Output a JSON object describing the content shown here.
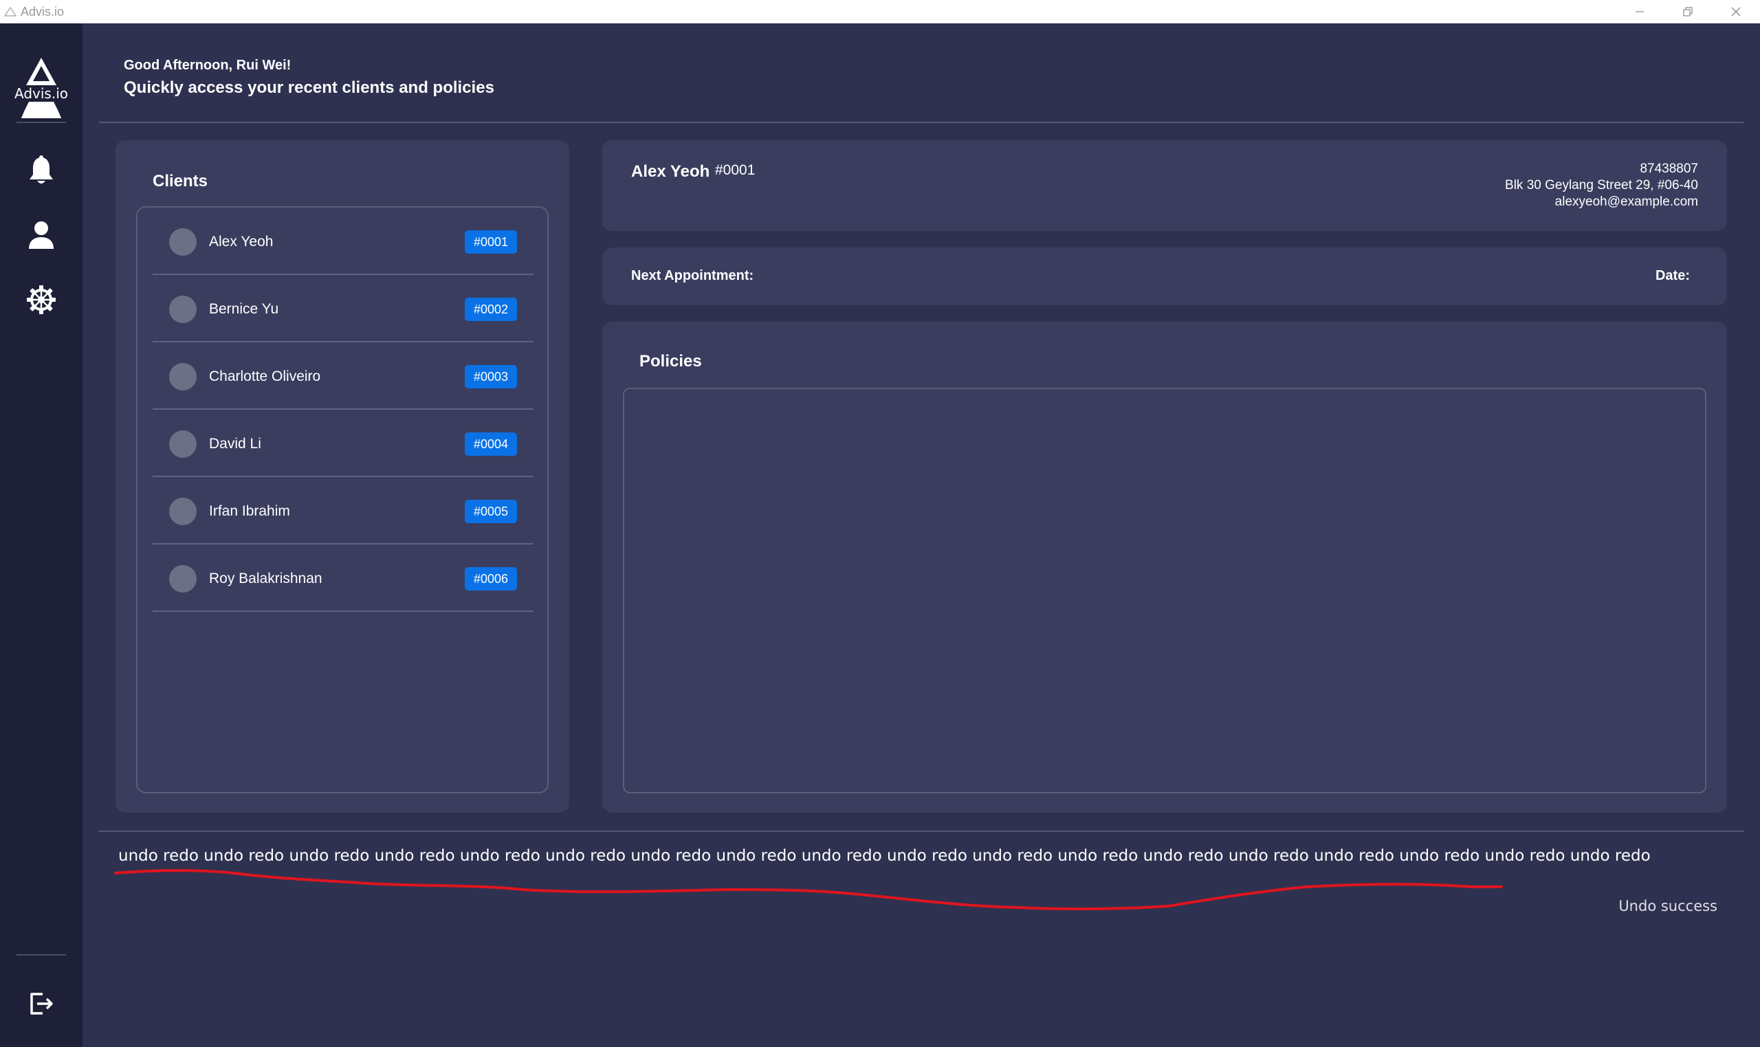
{
  "window": {
    "title": "Advis.io"
  },
  "sidebar": {
    "logo_text": "Advis.io",
    "items": [
      {
        "icon": "bell-icon"
      },
      {
        "icon": "user-icon"
      },
      {
        "icon": "gear-icon"
      }
    ],
    "logout_icon": "logout-icon"
  },
  "header": {
    "greeting": "Good Afternoon, Rui Wei!",
    "subtitle": "Quickly access your recent clients and policies"
  },
  "clients": {
    "title": "Clients",
    "items": [
      {
        "name": "Alex Yeoh",
        "id": "#0001"
      },
      {
        "name": "Bernice Yu",
        "id": "#0002"
      },
      {
        "name": "Charlotte Oliveiro",
        "id": "#0003"
      },
      {
        "name": "David Li",
        "id": "#0004"
      },
      {
        "name": "Irfan Ibrahim",
        "id": "#0005"
      },
      {
        "name": "Roy Balakrishnan",
        "id": "#0006"
      }
    ]
  },
  "detail": {
    "name": "Alex Yeoh",
    "id": "#0001",
    "phone": "87438807",
    "address": "Blk 30 Geylang Street 29, #06-40",
    "email": "alexyeoh@example.com"
  },
  "appointment": {
    "label": "Next Appointment:",
    "date_label": "Date:"
  },
  "policies": {
    "title": "Policies"
  },
  "command": {
    "input_value": "undo redo undo redo undo redo undo redo undo redo undo redo undo redo undo redo undo redo undo redo undo redo undo redo undo redo undo redo undo redo undo redo undo redo undo redo",
    "result": "Undo success"
  },
  "colors": {
    "sidebar_bg": "#1e2038",
    "panel_bg": "#3a3d5e",
    "page_bg": "#2f3150",
    "badge_blue": "#0a72e6",
    "annotation_red": "#e0141e"
  }
}
